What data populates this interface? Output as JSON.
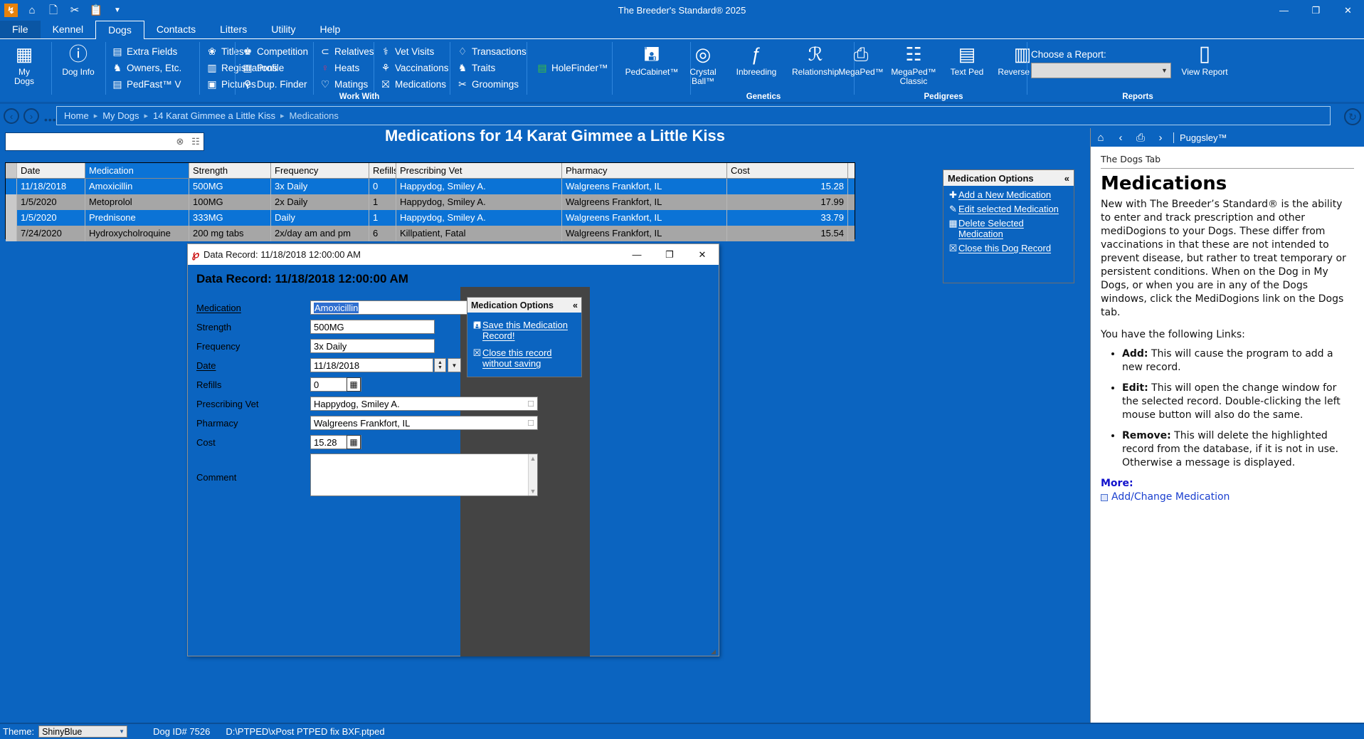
{
  "window": {
    "app_title": "The Breeder's Standard® 2025",
    "logo_text": "↯",
    "quick_access": [
      "home-icon",
      "copy-icon",
      "cut-icon",
      "paste-icon",
      "customize-icon"
    ],
    "minimize": "—",
    "maximize": "❐",
    "close": "✕",
    "help_icon": "?",
    "user_icon": "👤",
    "ribbon_icon": "▣"
  },
  "menu": {
    "tabs": [
      {
        "label": "File",
        "state": "file"
      },
      {
        "label": "Kennel",
        "state": "normal"
      },
      {
        "label": "Dogs",
        "state": "active"
      },
      {
        "label": "Contacts",
        "state": "normal"
      },
      {
        "label": "Litters",
        "state": "normal"
      },
      {
        "label": "Utility",
        "state": "normal"
      },
      {
        "label": "Help",
        "state": "normal"
      }
    ]
  },
  "ribbon": {
    "big_buttons": [
      {
        "label_line1": "My",
        "label_line2": "Dogs",
        "icon": "my-dogs-icon",
        "glyph": "⊞"
      },
      {
        "label_line1": "Dog Info",
        "label_line2": "",
        "icon": "dog-info-icon",
        "glyph": "ⓘ"
      }
    ],
    "columns": [
      {
        "items": [
          {
            "label": "Extra Fields",
            "icon": "extra-fields-icon",
            "glyph": "☰"
          },
          {
            "label": "Owners, Etc.",
            "icon": "owners-icon",
            "glyph": "♟"
          },
          {
            "label": "PedFast™ V",
            "icon": "pedfast-icon",
            "glyph": "▤"
          }
        ]
      },
      {
        "items": [
          {
            "label": "Titles",
            "icon": "titles-icon",
            "glyph": "❀"
          },
          {
            "label": "Registrations",
            "icon": "registrations-icon",
            "glyph": "▥"
          },
          {
            "label": "Pictures",
            "icon": "pictures-icon",
            "glyph": "▣"
          }
        ]
      },
      {
        "items": [
          {
            "label": "Competition",
            "icon": "competition-icon",
            "glyph": "♚"
          },
          {
            "label": "Profile",
            "icon": "profile-icon",
            "glyph": "▤"
          },
          {
            "label": "Dup. Finder",
            "icon": "dup-finder-icon",
            "glyph": "⚲"
          }
        ]
      },
      {
        "items": [
          {
            "label": "Relatives",
            "icon": "relatives-icon",
            "glyph": "⑂"
          },
          {
            "label": "Heats",
            "icon": "heats-icon",
            "glyph": "♀"
          },
          {
            "label": "Matings",
            "icon": "matings-icon",
            "glyph": "♡"
          }
        ]
      },
      {
        "items": [
          {
            "label": "Vet Visits",
            "icon": "vet-visits-icon",
            "glyph": "⚕"
          },
          {
            "label": "Vaccinations",
            "icon": "vaccinations-icon",
            "glyph": "✐"
          },
          {
            "label": "Medications",
            "icon": "medications-icon",
            "glyph": "☩"
          }
        ]
      },
      {
        "items": [
          {
            "label": "Transactions",
            "icon": "transactions-icon",
            "glyph": "♢"
          },
          {
            "label": "Traits",
            "icon": "traits-icon",
            "glyph": "♞"
          },
          {
            "label": "Groomings",
            "icon": "groomings-icon",
            "glyph": "✂"
          }
        ]
      }
    ],
    "holefinder": {
      "label": "HoleFinder™",
      "icon": "holefinder-icon",
      "glyph": "☰"
    },
    "pedcabinet": {
      "label": "PedCabinet™",
      "icon": "pedcabinet-icon",
      "glyph": "▦"
    },
    "genetics": {
      "label": "Genetics",
      "items": [
        {
          "label_line1": "Crystal",
          "label_line2": "Ball™",
          "icon": "crystal-ball-icon",
          "glyph": "◎"
        },
        {
          "label_line1": "Inbreeding",
          "label_line2": "",
          "icon": "inbreeding-icon",
          "glyph": "ƒ"
        },
        {
          "label_line1": "Relationship",
          "label_line2": "",
          "icon": "relationship-icon",
          "glyph": "ℛ"
        }
      ]
    },
    "pedigrees": {
      "label": "Pedigrees",
      "items": [
        {
          "label_line1": "MegaPed™",
          "label_line2": "",
          "icon": "megaped-icon",
          "glyph": "⎙"
        },
        {
          "label_line1": "MegaPed™",
          "label_line2": "Classic",
          "icon": "megaped-classic-icon",
          "glyph": "☷"
        },
        {
          "label_line1": "Text Ped",
          "label_line2": "",
          "icon": "text-ped-icon",
          "glyph": "☰"
        },
        {
          "label_line1": "Reverse Ped",
          "label_line2": "",
          "icon": "reverse-ped-icon",
          "glyph": "▤"
        }
      ]
    },
    "reports": {
      "label": "Reports",
      "choose_label": "Choose a Report:",
      "select_value": "",
      "view_report_label": "View Report",
      "view_report_icon": "view-report-icon"
    },
    "work_with_label": "Work With"
  },
  "nav": {
    "back_icon": "‹",
    "forward_icon": "›",
    "dots_icon": "•••",
    "refresh_icon": "↻",
    "breadcrumb": [
      "Home",
      "My Dogs",
      "14 Karat Gimmee a Little Kiss",
      "Medications"
    ],
    "separator": "▸"
  },
  "search": {
    "value": "",
    "placeholder": "",
    "clear_icon": "⊗",
    "filter_icon": "☷"
  },
  "page": {
    "title": "Medications for 14 Karat Gimmee a Little Kiss"
  },
  "grid": {
    "columns": [
      {
        "key": "date",
        "label": "Date"
      },
      {
        "key": "medication",
        "label": "Medication"
      },
      {
        "key": "strength",
        "label": "Strength"
      },
      {
        "key": "frequency",
        "label": "Frequency"
      },
      {
        "key": "refills",
        "label": "Refills"
      },
      {
        "key": "vet",
        "label": "Prescribing Vet"
      },
      {
        "key": "pharmacy",
        "label": "Pharmacy"
      },
      {
        "key": "cost",
        "label": "Cost"
      }
    ],
    "sorted_column": "Medication",
    "rows": [
      {
        "date": "11/18/2018",
        "medication": "Amoxicillin",
        "strength": "500MG",
        "frequency": "3x Daily",
        "refills": "0",
        "vet": "Happydog, Smiley A.",
        "pharmacy": "Walgreens Frankfort, IL",
        "cost": "15.28",
        "selected": true
      },
      {
        "date": "1/5/2020",
        "medication": "Metoprolol",
        "strength": "100MG",
        "frequency": "2x Daily",
        "refills": "1",
        "vet": "Happydog, Smiley A.",
        "pharmacy": "Walgreens Frankfort, IL",
        "cost": "17.99",
        "selected": false
      },
      {
        "date": "1/5/2020",
        "medication": "Prednisone",
        "strength": "333MG",
        "frequency": "Daily",
        "refills": "1",
        "vet": "Happydog, Smiley A.",
        "pharmacy": "Walgreens Frankfort, IL",
        "cost": "33.79",
        "selected": true
      },
      {
        "date": "7/24/2020",
        "medication": "Hydroxycholroquine",
        "strength": "200 mg tabs",
        "frequency": "2x/day am and pm",
        "refills": "6",
        "vet": "Killpatient, Fatal",
        "pharmacy": "Walgreens Frankfort, IL",
        "cost": "15.54",
        "selected": false
      }
    ]
  },
  "options_panel": {
    "title": "Medication Options",
    "collapse_icon": "«",
    "items": [
      {
        "label": "Add a New Medication",
        "icon": "plus-icon",
        "glyph": "✚"
      },
      {
        "label": "Edit selected Medication",
        "icon": "pencil-icon",
        "glyph": "✎"
      },
      {
        "label": "Delete Selected Medication",
        "icon": "delete-row-icon",
        "glyph": "▦"
      },
      {
        "label": "Close this Dog Record",
        "icon": "close-box-icon",
        "glyph": "⌧"
      }
    ]
  },
  "help": {
    "toolbar": {
      "home_icon": "⌂",
      "back_icon": "‹",
      "print_icon": "⎙",
      "forward_icon": "›",
      "brand": "Puggsley™"
    },
    "breadcrumb": "The Dogs Tab",
    "heading": "Medications",
    "paragraph": "New with The Breeder’s Standard® is the ability to enter and track prescription and other mediDogions to your Dogs.  These differ from vaccinations in that these are not intended to prevent disease, but rather to treat temporary or persistent conditions. When on the Dog in My Dogs, or when you are in any of the Dogs windows, click the MediDogions link on the Dogs tab.",
    "links_intro": "You have the following Links:",
    "bullets": [
      {
        "term": "Add:",
        "text": " This will cause the program to add a new record."
      },
      {
        "term": "Edit:",
        "text": " This will open the change window for the selected record. Double-clicking the left mouse button will also do the same."
      },
      {
        "term": "Remove:",
        "text": " This will delete the highlighted record from the database, if it is not in use. Otherwise a message is displayed."
      }
    ],
    "more_title": "More:",
    "more_link": "Add/Change Medication"
  },
  "dialog": {
    "title": "Data Record: 11/18/2018 12:00:00 AM",
    "heading": "Data Record: 11/18/2018 12:00:00 AM",
    "icon": "app-record-icon",
    "minimize": "—",
    "maximize": "❐",
    "close": "✕",
    "fields": [
      {
        "label": "Medication",
        "value": "Amoxicillin",
        "underlined": true,
        "type": "lookup",
        "selected_text": true
      },
      {
        "label": "Strength",
        "value": "500MG",
        "underlined": false,
        "type": "text"
      },
      {
        "label": "Frequency",
        "value": "3x Daily",
        "underlined": false,
        "type": "text"
      },
      {
        "label": "Date",
        "value": "11/18/2018",
        "underlined": true,
        "type": "date"
      },
      {
        "label": "Refills",
        "value": "0",
        "underlined": false,
        "type": "number"
      },
      {
        "label": "Prescribing Vet",
        "value": "Happydog, Smiley A.",
        "underlined": false,
        "type": "lookup"
      },
      {
        "label": "Pharmacy",
        "value": "Walgreens Frankfort, IL",
        "underlined": false,
        "type": "lookup"
      },
      {
        "label": "Cost",
        "value": "15.28",
        "underlined": false,
        "type": "number"
      }
    ],
    "comment_label": "Comment",
    "comment_value": "",
    "options": {
      "title": "Medication Options",
      "collapse_icon": "«",
      "items": [
        {
          "label": "Save this Medication Record!",
          "icon": "save-icon",
          "glyph": "Ὃe"
        },
        {
          "label": "Close this record without saving",
          "icon": "close-box-icon",
          "glyph": "⌧"
        }
      ]
    }
  },
  "statusbar": {
    "theme_label": "Theme:",
    "theme_value": "ShinyBlue",
    "dog_id": "Dog ID# 7526",
    "db_path": "D:\\PTPED\\xPost PTPED fix BXF.ptped"
  },
  "colors": {
    "chrome_blue": "#0b64c0",
    "selection_blue": "#0b73d6",
    "alt_row_gray": "#a6a6a6",
    "panel_gray": "#444444"
  }
}
